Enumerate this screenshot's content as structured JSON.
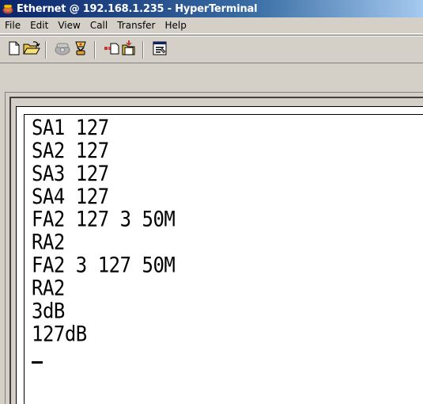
{
  "window": {
    "title": "Ethernet @ 192.168.1.235 - HyperTerminal",
    "title_icon": "hyperterminal-phone-icon",
    "colors": {
      "titlebar_start": "#0a246a",
      "titlebar_end": "#a6caf0",
      "chrome": "#d4d0c8",
      "terminal_bg": "#ffffff",
      "terminal_text": "#000000"
    }
  },
  "menu": {
    "items": [
      {
        "label": "File"
      },
      {
        "label": "Edit"
      },
      {
        "label": "View"
      },
      {
        "label": "Call"
      },
      {
        "label": "Transfer"
      },
      {
        "label": "Help"
      }
    ]
  },
  "toolbar": {
    "buttons": [
      {
        "icon": "new-icon"
      },
      {
        "icon": "open-icon"
      },
      {
        "icon": "connect-icon"
      },
      {
        "icon": "disconnect-icon"
      },
      {
        "icon": "send-icon"
      },
      {
        "icon": "receive-icon"
      },
      {
        "icon": "properties-icon"
      }
    ]
  },
  "terminal": {
    "lines": [
      "SA1 127",
      "SA2 127",
      "SA3 127",
      "SA4 127",
      "FA2 127 3 50M",
      "RA2",
      "FA2 3 127 50M",
      "RA2",
      "3dB",
      "127dB"
    ]
  }
}
